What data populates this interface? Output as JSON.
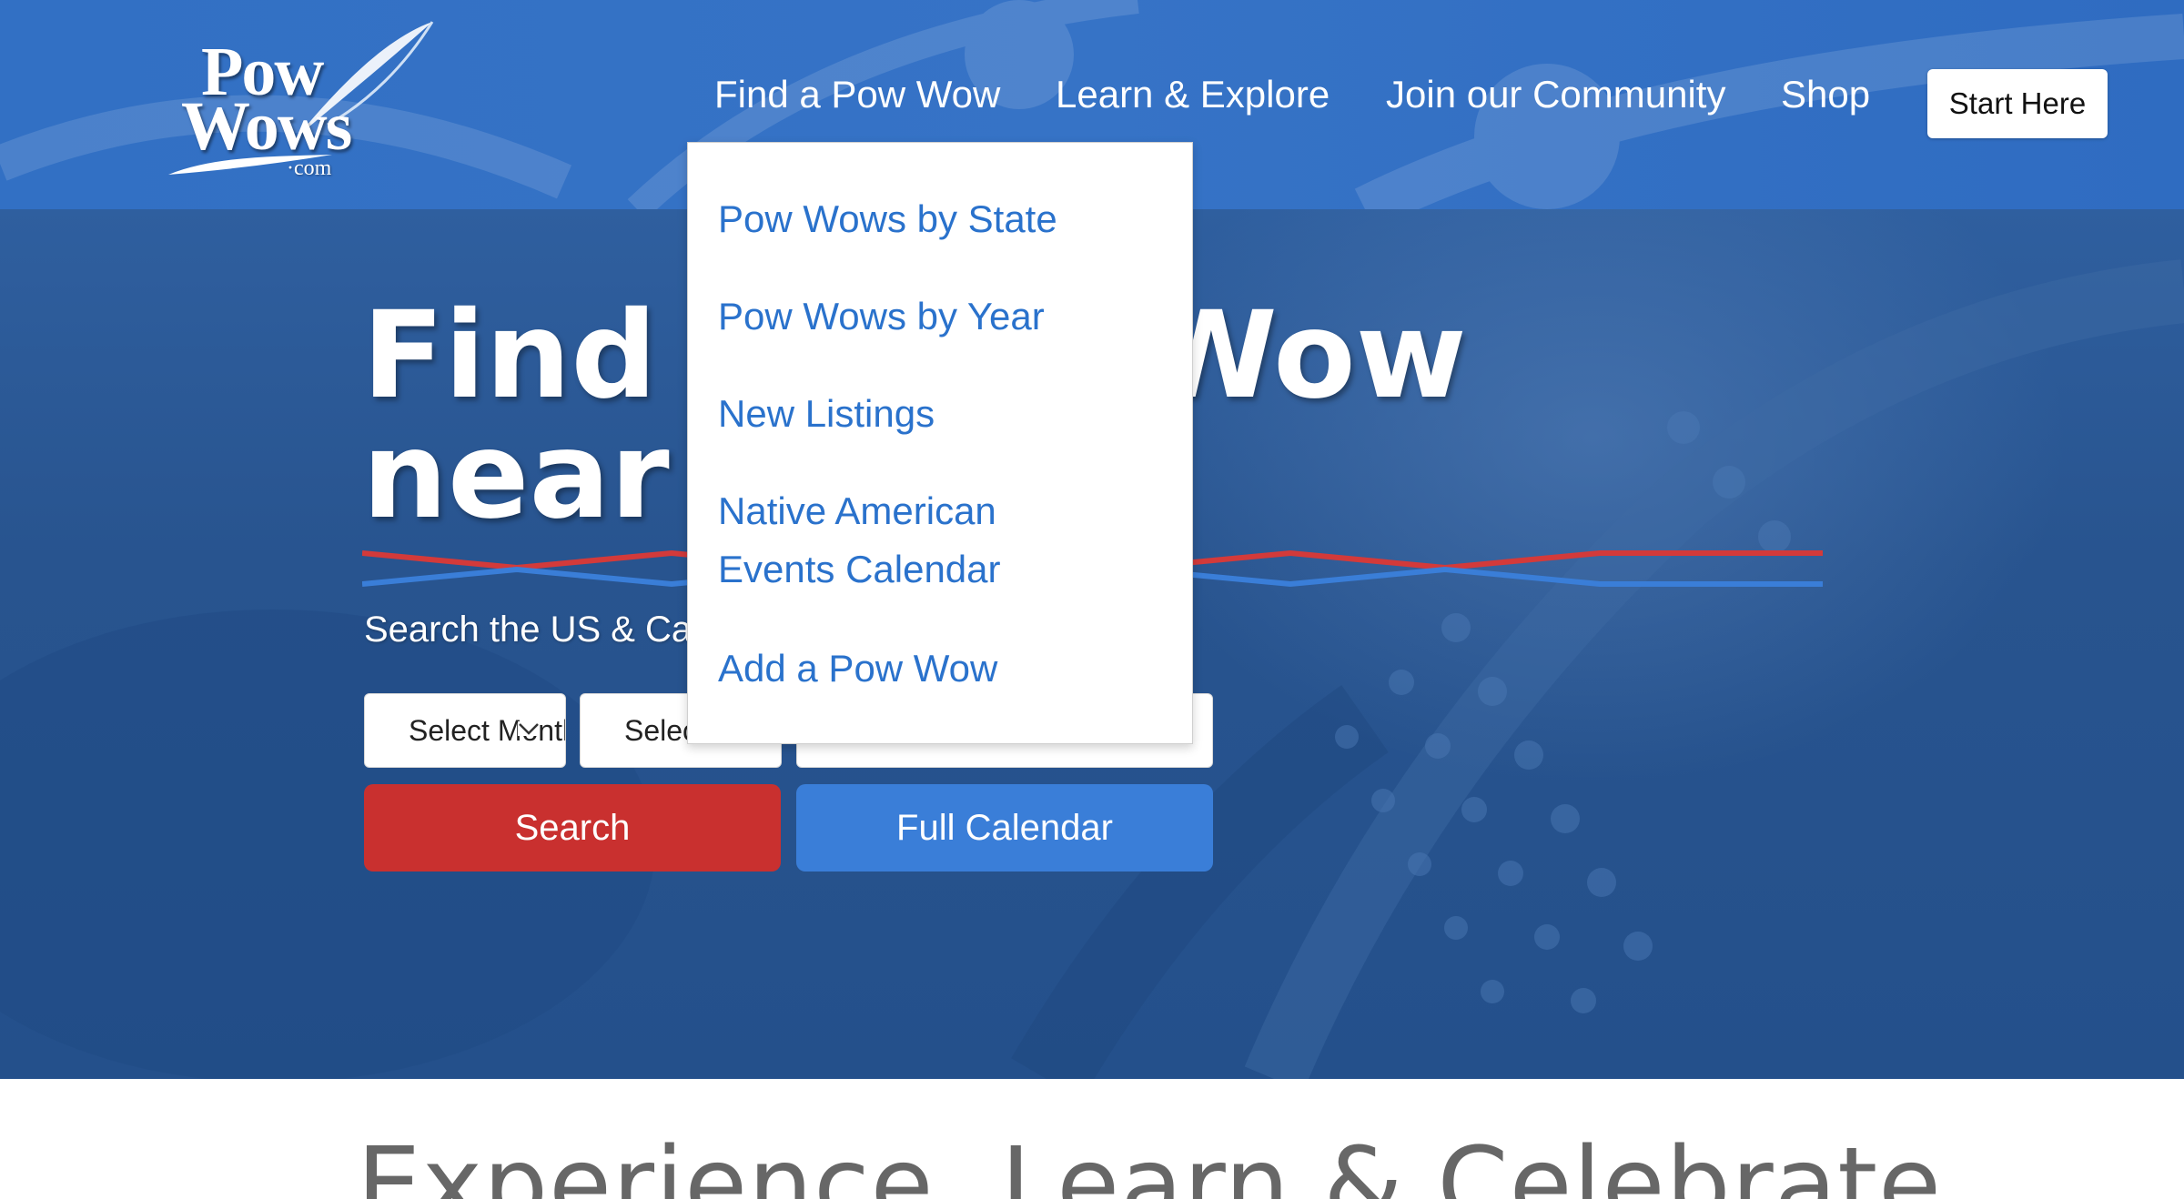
{
  "header": {
    "logo": {
      "line1": "Pow",
      "line2": "Wows",
      "suffix": "·com"
    },
    "nav": [
      {
        "label": "Find a Pow Wow"
      },
      {
        "label": "Learn & Explore"
      },
      {
        "label": "Join our Community"
      },
      {
        "label": "Shop"
      }
    ],
    "cta_label": "Start Here"
  },
  "hero": {
    "title_line1": "Find a Pow Wow",
    "title_line2": "near you",
    "subtitle": "Search the US & Canada",
    "selects": [
      {
        "value": "Select Month"
      },
      {
        "value": "Select State"
      },
      {
        "value": ""
      }
    ],
    "search_label": "Search",
    "calendar_label": "Full Calendar"
  },
  "dropdown": {
    "items": [
      {
        "label": "Pow Wows by State"
      },
      {
        "label": "Pow Wows by Year"
      },
      {
        "label": "New Listings"
      },
      {
        "label_line1": "Native American",
        "label_line2": "Events Calendar"
      },
      {
        "label": "Add a Pow Wow"
      }
    ]
  },
  "section": {
    "title": "Experience, Learn & Celebrate"
  },
  "colors": {
    "header_bg": "#3270c4",
    "hero_bg": "#28548f",
    "search_button": "#c9302f",
    "calendar_button": "#3a7ed8",
    "link_blue": "#2a72cc"
  }
}
